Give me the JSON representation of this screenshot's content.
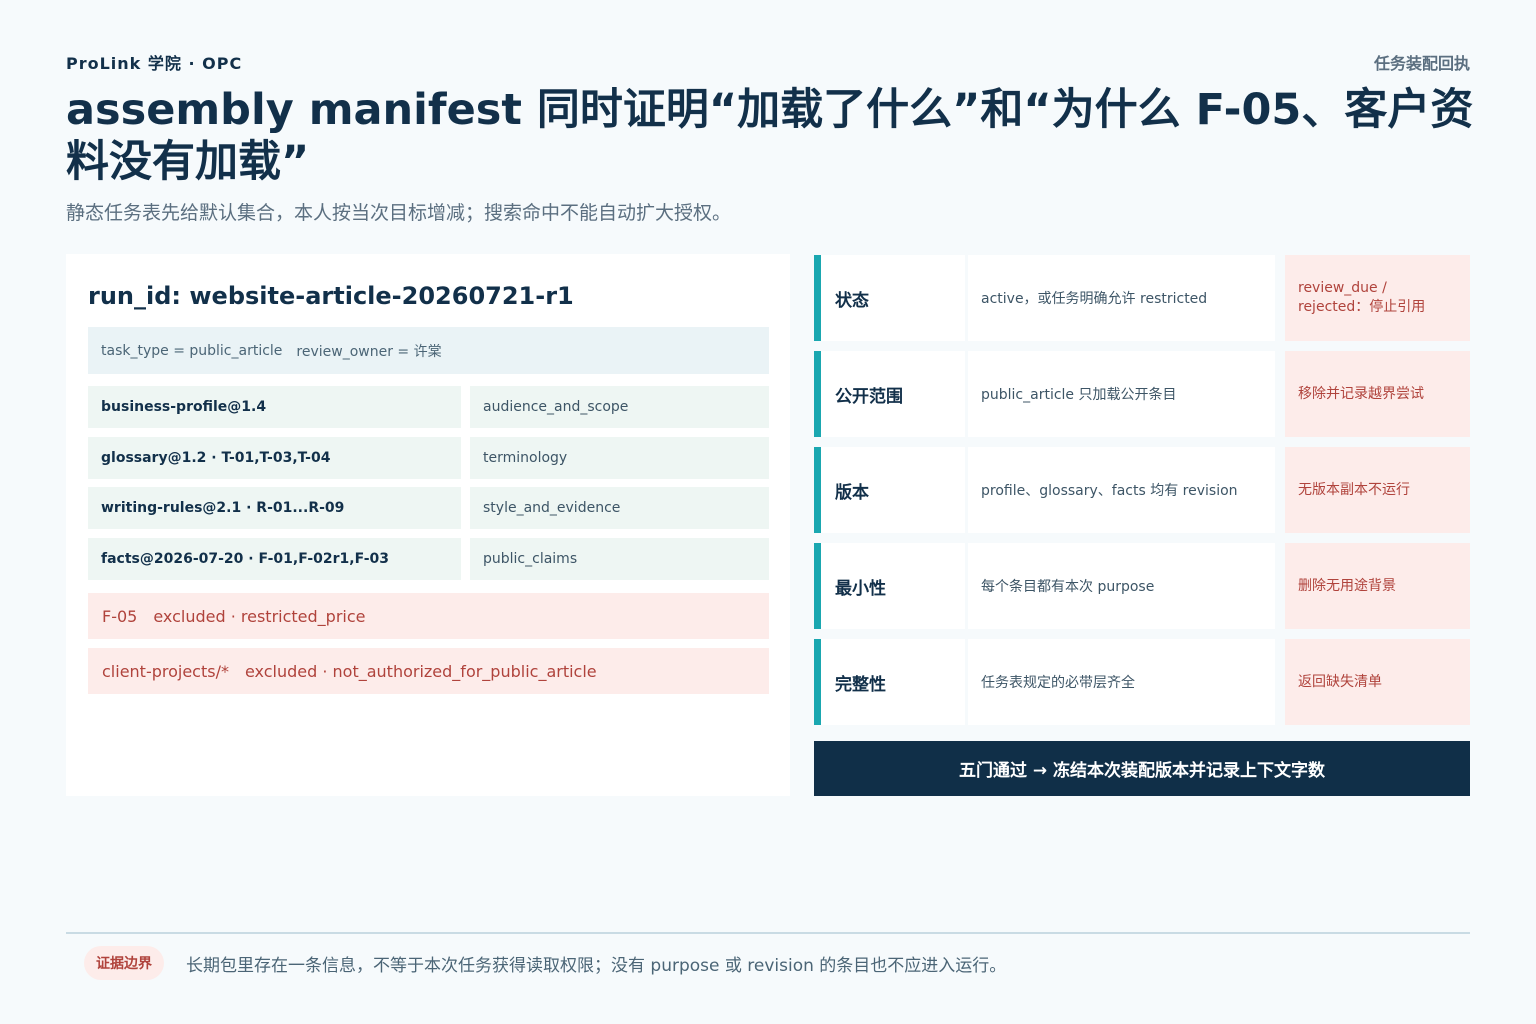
{
  "header": {
    "brand": "ProLink 学院 · OPC",
    "top_tag": "任务装配回执",
    "title": "assembly manifest 同时证明“加载了什么”和“为什么 F-05、客户资料没有加载”",
    "subtitle": "静态任务表先给默认集合，本人按当次目标增减；搜索命中不能自动扩大授权。"
  },
  "manifest": {
    "run_id": "run_id: website-article-20260721-r1",
    "meta": [
      "task_type = public_article",
      "review_owner = 许棠"
    ],
    "items": [
      {
        "source": "business-profile@1.4",
        "purpose": "audience_and_scope"
      },
      {
        "source": "glossary@1.2 · T-01,T-03,T-04",
        "purpose": "terminology"
      },
      {
        "source": "writing-rules@2.1 · R-01...R-09",
        "purpose": "style_and_evidence"
      },
      {
        "source": "facts@2026-07-20 · F-01,F-02r1,F-03",
        "purpose": "public_claims"
      }
    ],
    "excluded": [
      {
        "id": "F-05",
        "reason": "excluded · restricted_price"
      },
      {
        "id": "client-projects/*",
        "reason": "excluded · not_authorized_for_public_article"
      }
    ]
  },
  "gates": [
    {
      "name": "状态",
      "rule": "active，或任务明确允许 restricted",
      "fail": "review_due / rejected：停止引用"
    },
    {
      "name": "公开范围",
      "rule": "public_article 只加载公开条目",
      "fail": "移除并记录越界尝试"
    },
    {
      "name": "版本",
      "rule": "profile、glossary、facts 均有 revision",
      "fail": "无版本副本不运行"
    },
    {
      "name": "最小性",
      "rule": "每个条目都有本次 purpose",
      "fail": "删除无用途背景"
    },
    {
      "name": "完整性",
      "rule": "任务表规定的必带层齐全",
      "fail": "返回缺失清单"
    }
  ],
  "banner": "五门通过 → 冻结本次装配版本并记录上下文字数",
  "footer": {
    "badge": "证据边界",
    "note": "长期包里存在一条信息，不等于本次任务获得读取权限；没有 purpose 或 revision 的条目也不应进入运行。"
  },
  "colors": {
    "navy": "#102f48",
    "accent_teal": "#1aa7b0",
    "warning_bg": "#fdecea",
    "warning_text": "#b0433c"
  }
}
